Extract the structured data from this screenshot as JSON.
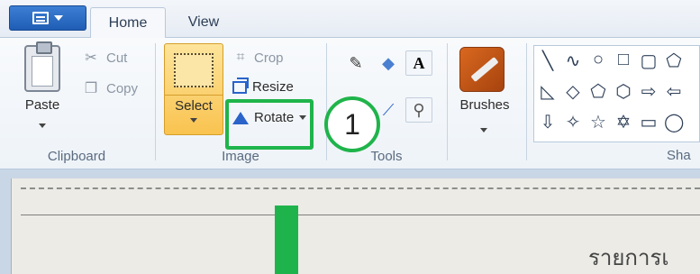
{
  "tabs": {
    "home": "Home",
    "view": "View"
  },
  "clipboard": {
    "paste_label": "Paste",
    "cut_label": "Cut",
    "copy_label": "Copy",
    "group_label": "Clipboard"
  },
  "image": {
    "select_label": "Select",
    "crop_label": "Crop",
    "resize_label": "Resize",
    "rotate_label": "Rotate",
    "group_label": "Image"
  },
  "tools": {
    "group_label": "Tools"
  },
  "brushes": {
    "label": "Brushes"
  },
  "shapes": {
    "group_label": "Sha"
  },
  "annotation": {
    "step_number": "1",
    "highlight_color": "#1fb44b"
  },
  "canvas": {
    "text": "รายการเ"
  },
  "colors": {
    "file_button": "#2a6bc4",
    "select_active": "#f9c34f",
    "accent_blue": "#2a63c9"
  }
}
